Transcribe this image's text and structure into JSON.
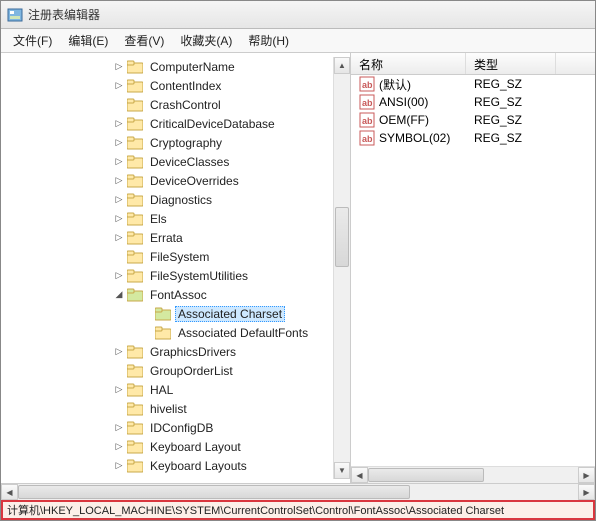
{
  "title": "注册表编辑器",
  "menus": {
    "file": "文件(F)",
    "edit": "编辑(E)",
    "view": "查看(V)",
    "fav": "收藏夹(A)",
    "help": "帮助(H)"
  },
  "tree_nodes": [
    {
      "label": "ComputerName",
      "toggle": "▷"
    },
    {
      "label": "ContentIndex",
      "toggle": "▷"
    },
    {
      "label": "CrashControl",
      "toggle": ""
    },
    {
      "label": "CriticalDeviceDatabase",
      "toggle": "▷"
    },
    {
      "label": "Cryptography",
      "toggle": "▷"
    },
    {
      "label": "DeviceClasses",
      "toggle": "▷"
    },
    {
      "label": "DeviceOverrides",
      "toggle": "▷"
    },
    {
      "label": "Diagnostics",
      "toggle": "▷"
    },
    {
      "label": "Els",
      "toggle": "▷"
    },
    {
      "label": "Errata",
      "toggle": "▷"
    },
    {
      "label": "FileSystem",
      "toggle": ""
    },
    {
      "label": "FileSystemUtilities",
      "toggle": "▷"
    },
    {
      "label": "FontAssoc",
      "toggle": "◢",
      "expanded": true,
      "children": [
        {
          "label": "Associated Charset",
          "selected": true
        },
        {
          "label": "Associated DefaultFonts"
        }
      ]
    },
    {
      "label": "GraphicsDrivers",
      "toggle": "▷"
    },
    {
      "label": "GroupOrderList",
      "toggle": ""
    },
    {
      "label": "HAL",
      "toggle": "▷"
    },
    {
      "label": "hivelist",
      "toggle": ""
    },
    {
      "label": "IDConfigDB",
      "toggle": "▷"
    },
    {
      "label": "Keyboard Layout",
      "toggle": "▷"
    },
    {
      "label": "Keyboard Layouts",
      "toggle": "▷"
    }
  ],
  "list": {
    "headers": {
      "name": "名称",
      "type": "类型"
    },
    "rows": [
      {
        "name": "(默认)",
        "type": "REG_SZ"
      },
      {
        "name": "ANSI(00)",
        "type": "REG_SZ"
      },
      {
        "name": "OEM(FF)",
        "type": "REG_SZ"
      },
      {
        "name": "SYMBOL(02)",
        "type": "REG_SZ"
      }
    ]
  },
  "status_path": "计算机\\HKEY_LOCAL_MACHINE\\SYSTEM\\CurrentControlSet\\Control\\FontAssoc\\Associated Charset"
}
